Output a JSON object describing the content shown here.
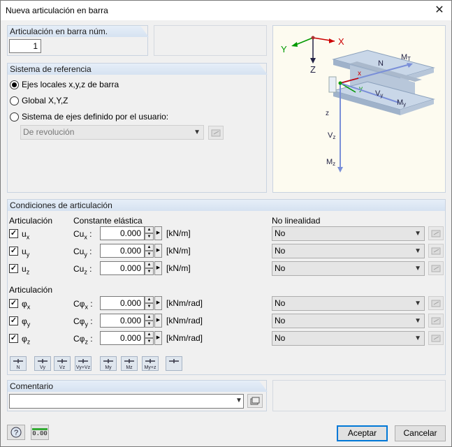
{
  "window": {
    "title": "Nueva articulación en barra",
    "close_glyph": "✕"
  },
  "member_no": {
    "label": "Articulación en barra núm.",
    "value": "1"
  },
  "ref_system": {
    "label": "Sistema de referencia",
    "opt_local": "Ejes locales x,y,z de barra",
    "opt_global": "Global X,Y,Z",
    "opt_user": "Sistema de ejes definido por el usuario:",
    "user_select": "De revolución"
  },
  "figure": {
    "labels": {
      "X": "X",
      "Y": "Y",
      "Z": "Z",
      "x": "x",
      "y": "y",
      "z": "z",
      "N": "N",
      "MT": "M",
      "MT_sub": "T",
      "Vy": "V",
      "Vy_sub": "y",
      "My": "M",
      "My_sub": "y",
      "Vz": "V",
      "Vz_sub": "z",
      "Mz": "M",
      "Mz_sub": "z"
    }
  },
  "conditions": {
    "label": "Condiciones de articulación",
    "col_release": "Articulación",
    "col_spring": "Constante elástica",
    "col_nonlin": "No linealidad",
    "sub_release": "Articulación",
    "translations": [
      {
        "name": "u",
        "sub": "x",
        "spring": "Cu",
        "spring_sub": "x",
        "value": "0.000",
        "unit": "[kN/m]",
        "nonlin": "No",
        "checked": true
      },
      {
        "name": "u",
        "sub": "y",
        "spring": "Cu",
        "spring_sub": "y",
        "value": "0.000",
        "unit": "[kN/m]",
        "nonlin": "No",
        "checked": true
      },
      {
        "name": "u",
        "sub": "z",
        "spring": "Cu",
        "spring_sub": "z",
        "value": "0.000",
        "unit": "[kN/m]",
        "nonlin": "No",
        "checked": true
      }
    ],
    "rotations": [
      {
        "name": "φ",
        "sub": "x",
        "spring": "Cφ",
        "spring_sub": "x",
        "value": "0.000",
        "unit": "[kNm/rad]",
        "nonlin": "No",
        "checked": true
      },
      {
        "name": "φ",
        "sub": "y",
        "spring": "Cφ",
        "spring_sub": "y",
        "value": "0.000",
        "unit": "[kNm/rad]",
        "nonlin": "No",
        "checked": true
      },
      {
        "name": "φ",
        "sub": "z",
        "spring": "Cφ",
        "spring_sub": "z",
        "value": "0.000",
        "unit": "[kNm/rad]",
        "nonlin": "No",
        "checked": true
      }
    ],
    "toolbar": [
      {
        "icon": "release-N-icon",
        "text": "N"
      },
      {
        "icon": "release-Vy-icon",
        "text": "Vy"
      },
      {
        "icon": "release-Vz-icon",
        "text": "Vz"
      },
      {
        "icon": "release-Vy-Vz-icon",
        "text": "Vy+Vz"
      },
      {
        "icon": "release-My-icon",
        "text": "My"
      },
      {
        "icon": "release-Mz-icon",
        "text": "Mz"
      },
      {
        "icon": "release-My-Mz-icon",
        "text": "My+z"
      },
      {
        "icon": "release-clear-icon",
        "text": ""
      }
    ]
  },
  "comment": {
    "label": "Comentario",
    "value": ""
  },
  "footer": {
    "ok": "Aceptar",
    "cancel": "Cancelar",
    "units_icon": "0.00"
  },
  "colors": {
    "accent": "#0078d7",
    "group_header": "#d6e2f1"
  }
}
